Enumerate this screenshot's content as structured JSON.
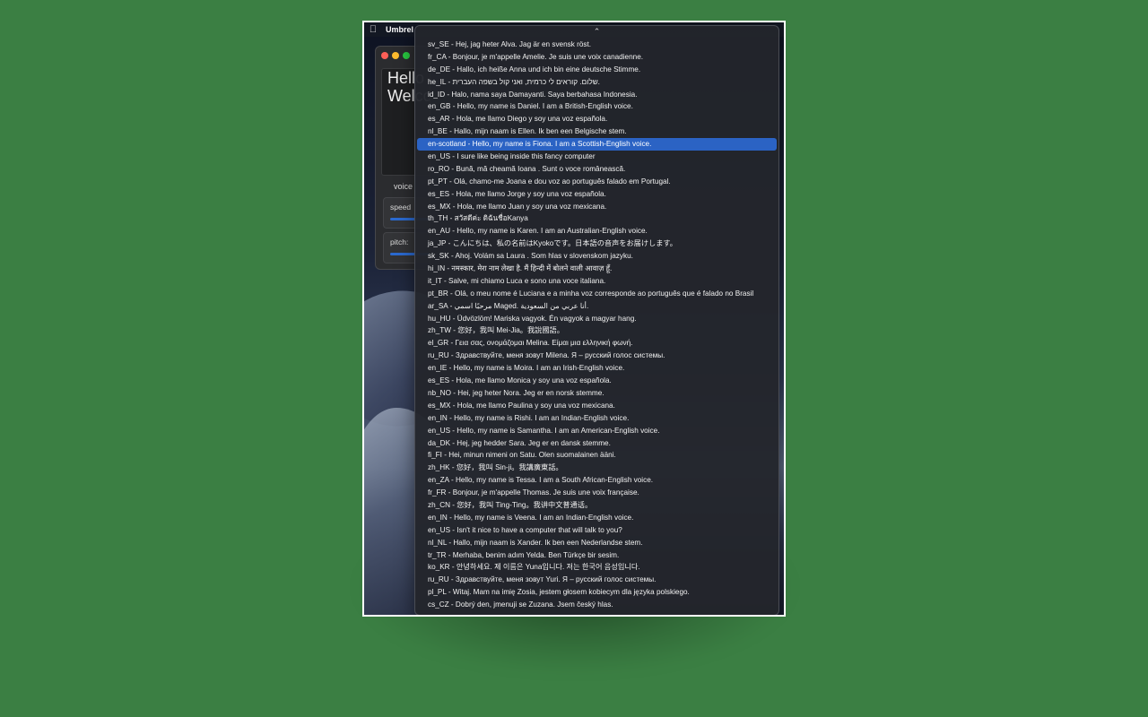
{
  "menubar": {
    "app_name": "Umbrel"
  },
  "app_window": {
    "text_lines": [
      "Hello",
      "Welcome"
    ],
    "voice_label": "voice",
    "speed_label": "speed",
    "pitch_label": "pitch:"
  },
  "voice_menu": {
    "scroll_up_glyph": "⌃",
    "selected_index": 8,
    "items": [
      "sv_SE  -  Hej, jag heter Alva. Jag är en svensk röst.",
      "fr_CA  -  Bonjour, je m'appelle Amelie. Je suis une voix canadienne.",
      "de_DE  -  Hallo, ich heiße Anna und ich bin eine deutsche Stimme.",
      "he_IL  -  שלום. קוראים לי כרמית, ואני קול בשפה העברית.",
      "id_ID  -  Halo, nama saya Damayanti. Saya berbahasa Indonesia.",
      "en_GB  -  Hello, my name is Daniel. I am a British-English voice.",
      "es_AR  -  Hola, me llamo Diego y soy una voz española.",
      "nl_BE  -  Hallo, mijn naam is Ellen. Ik ben een Belgische stem.",
      "en-scotland  -  Hello, my name is Fiona. I am a Scottish-English voice.",
      "en_US  -  I sure like being inside this fancy computer",
      "ro_RO  -  Bună, mă cheamă Ioana . Sunt o voce românească.",
      "pt_PT  -  Olá, chamo-me Joana e dou voz ao português falado em Portugal.",
      "es_ES  -  Hola, me llamo Jorge y soy una voz española.",
      "es_MX  -  Hola, me llamo Juan y soy una voz mexicana.",
      "th_TH  -  สวัสดีค่ะ ดิฉันชื่อKanya",
      "en_AU  -  Hello, my name is Karen. I am an Australian-English voice.",
      "ja_JP  -  こんにちは、私の名前はKyokoです。日本語の音声をお届けします。",
      "sk_SK  -  Ahoj. Volám sa Laura . Som hlas v slovenskom jazyku.",
      "hi_IN  -  नमस्कार, मेरा नाम लेखा है. मैं हिन्दी में बोलने वाली आवाज़ हूँ.",
      "it_IT  -  Salve, mi chiamo Luca e sono una voce italiana.",
      "pt_BR  -  Olá, o meu nome é Luciana e a minha voz corresponde ao português que é falado no Brasil",
      "ar_SA  -  مرحبًا اسمي Maged. أنا عربي من السعودية.",
      "hu_HU  -  Üdvözlöm! Mariska vagyok. Én vagyok a magyar hang.",
      "zh_TW  -  您好，我叫 Mei-Jia。我說國語。",
      "el_GR  -  Γεια σας, ονομάζομαι Melina. Είμαι μια ελληνική φωνή.",
      "ru_RU  -  Здравствуйте, меня зовут Milena. Я – русский голос системы.",
      "en_IE  -  Hello, my name is Moira. I am an Irish-English voice.",
      "es_ES  -  Hola, me llamo Monica y soy una voz española.",
      "nb_NO  -  Hei, jeg heter Nora. Jeg er en norsk stemme.",
      "es_MX  -  Hola, me llamo Paulina y soy una voz mexicana.",
      "en_IN  -  Hello, my name is Rishi. I am an Indian-English voice.",
      "en_US  -  Hello, my name is Samantha. I am an American-English voice.",
      "da_DK  -  Hej, jeg hedder Sara. Jeg er en dansk stemme.",
      "fi_FI  -  Hei, minun nimeni on Satu. Olen suomalainen ääni.",
      "zh_HK  -  您好，我叫 Sin-ji。我講廣東話。",
      "en_ZA  -  Hello, my name is Tessa. I am a South African-English voice.",
      "fr_FR  -  Bonjour, je m'appelle Thomas. Je suis une voix française.",
      "zh_CN  -  您好，我叫 Ting-Ting。我讲中文普通话。",
      "en_IN  -  Hello, my name is Veena. I am an Indian-English voice.",
      "en_US  -  Isn't it nice to have a computer that will talk to you?",
      "nl_NL  -  Hallo, mijn naam is Xander. Ik ben een Nederlandse stem.",
      "tr_TR  -  Merhaba, benim adım Yelda. Ben Türkçe bir sesim.",
      "ko_KR  -  안녕하세요. 제 이름은 Yuna입니다. 저는 한국어 음성입니다.",
      "ru_RU  -  Здравствуйте, меня зовут Yuri. Я – русский голос системы.",
      "pl_PL  -  Witaj. Mam na imię Zosia, jestem głosem kobiecym dla języka polskiego.",
      "cs_CZ  -  Dobrý den, jmenuji se Zuzana. Jsem český hlas."
    ]
  },
  "colors": {
    "page_background": "#3b7f43",
    "selection": "#2b63c4",
    "menu_background": "#23252c"
  },
  "icons": {
    "apple": "apple-logo-icon",
    "scroll_up": "chevron-up-icon"
  }
}
